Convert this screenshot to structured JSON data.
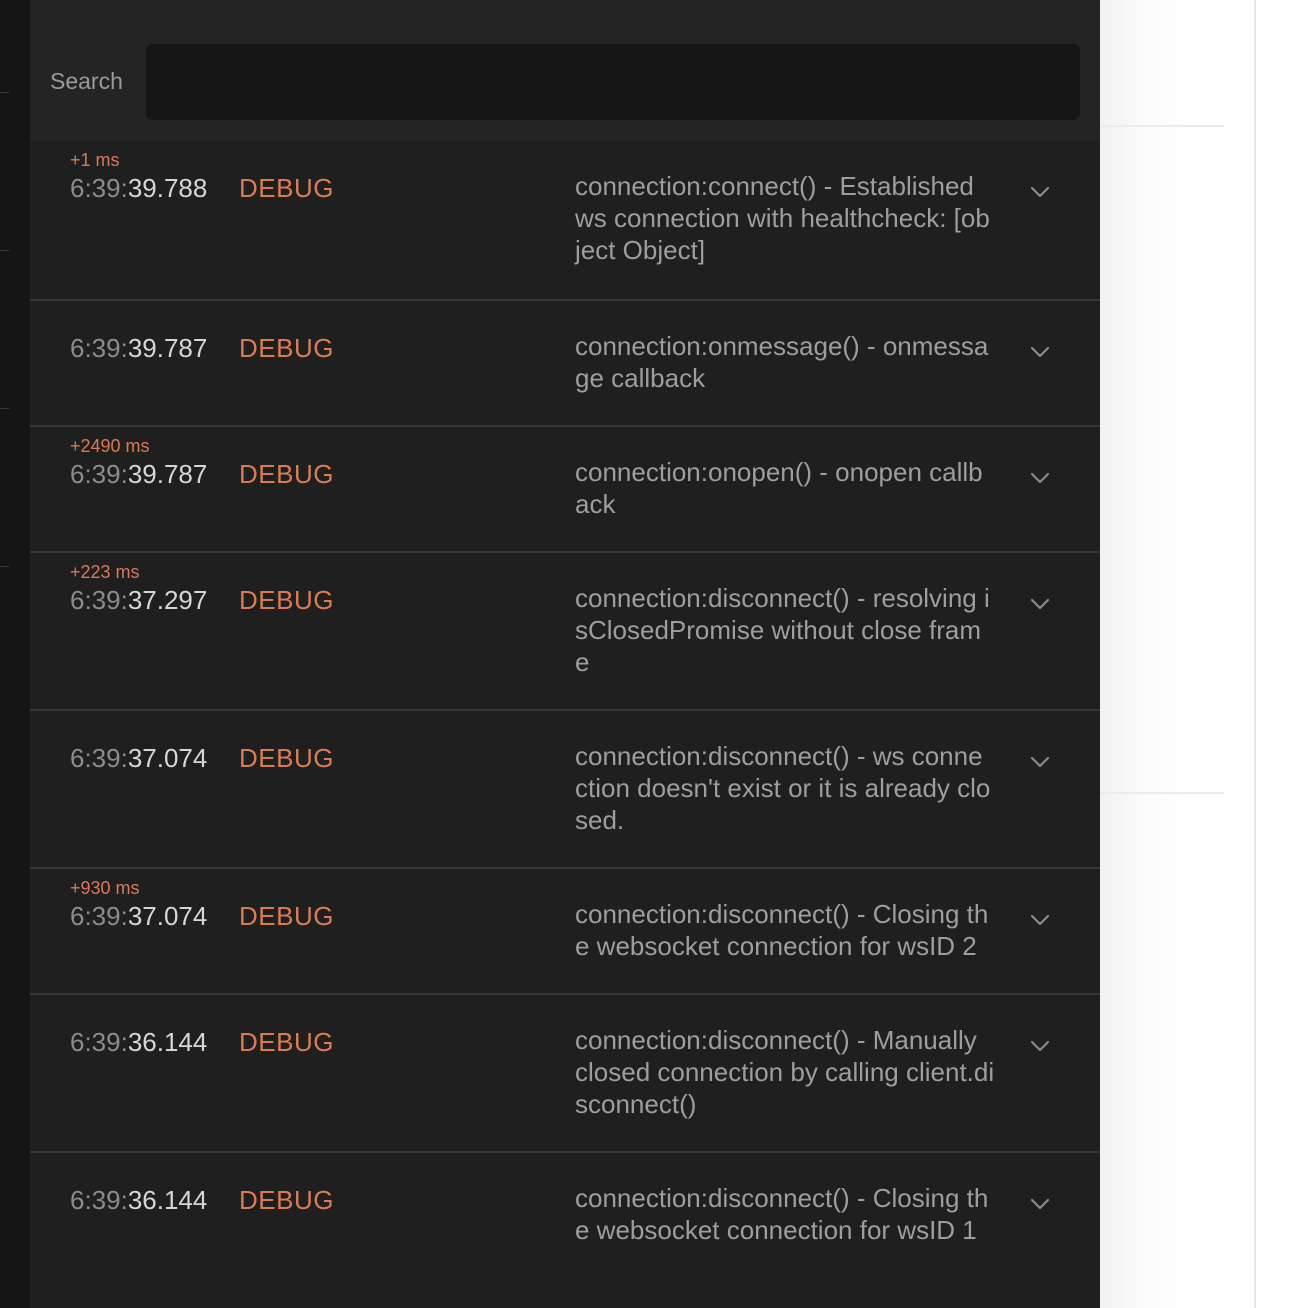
{
  "search": {
    "label": "Search",
    "value": "",
    "placeholder": ""
  },
  "colors": {
    "panel_bg": "#1f1f1f",
    "search_input_bg": "#161616",
    "level_color": "#d97c56",
    "delta_color": "#d77a55"
  },
  "logs": [
    {
      "delta": "+1 ms",
      "time_hm": "6:39:",
      "time_sms": "39.788",
      "level": "DEBUG",
      "message": "connection:connect() - Established ws connection with healthcheck: [object Object]"
    },
    {
      "delta": "",
      "time_hm": "6:39:",
      "time_sms": "39.787",
      "level": "DEBUG",
      "message": "connection:onmessage() - onmessage callback"
    },
    {
      "delta": "+2490 ms",
      "time_hm": "6:39:",
      "time_sms": "39.787",
      "level": "DEBUG",
      "message": "connection:onopen() - onopen callback"
    },
    {
      "delta": "+223 ms",
      "time_hm": "6:39:",
      "time_sms": "37.297",
      "level": "DEBUG",
      "message": "connection:disconnect() - resolving isClosedPromise without close frame"
    },
    {
      "delta": "",
      "time_hm": "6:39:",
      "time_sms": "37.074",
      "level": "DEBUG",
      "message": "connection:disconnect() - ws connection doesn't exist or it is already closed."
    },
    {
      "delta": "+930 ms",
      "time_hm": "6:39:",
      "time_sms": "37.074",
      "level": "DEBUG",
      "message": "connection:disconnect() - Closing the websocket connection for wsID 2"
    },
    {
      "delta": "",
      "time_hm": "6:39:",
      "time_sms": "36.144",
      "level": "DEBUG",
      "message": "connection:disconnect() - Manually closed connection by calling client.disconnect()"
    },
    {
      "delta": "",
      "time_hm": "6:39:",
      "time_sms": "36.144",
      "level": "DEBUG",
      "message": "connection:disconnect() - Closing the websocket connection for wsID 1"
    }
  ]
}
